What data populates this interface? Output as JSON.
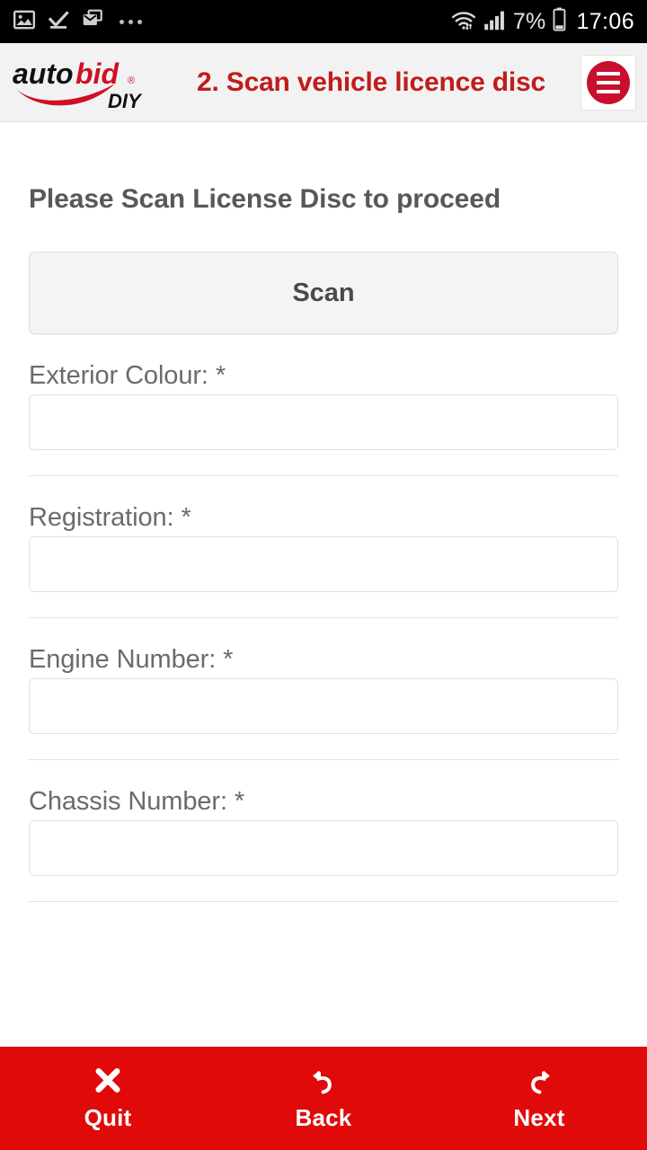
{
  "status_bar": {
    "left_icons": [
      "image-icon",
      "download-complete-icon",
      "email-icon",
      "more-icon"
    ],
    "wifi_icon": "wifi-icon",
    "signal_icon": "signal-bars-icon",
    "battery_percent": "7%",
    "battery_icon": "battery-icon",
    "time": "17:06"
  },
  "header": {
    "logo_text_1": "auto",
    "logo_text_2": "bid",
    "logo_registered": "®",
    "logo_sub": "DIY",
    "title": "2. Scan vehicle licence disc",
    "menu_icon": "hamburger-menu-icon"
  },
  "main": {
    "page_title": "Please Scan License Disc to proceed",
    "scan_label": "Scan",
    "fields": [
      {
        "label": "Exterior Colour: *",
        "value": "",
        "placeholder": ""
      },
      {
        "label": "Registration: *",
        "value": "",
        "placeholder": ""
      },
      {
        "label": "Engine Number: *",
        "value": "",
        "placeholder": ""
      },
      {
        "label": "Chassis Number: *",
        "value": "",
        "placeholder": ""
      }
    ]
  },
  "nav": {
    "buttons": [
      {
        "label": "Quit",
        "icon": "close-x-icon"
      },
      {
        "label": "Back",
        "icon": "undo-arrow-icon"
      },
      {
        "label": "Next",
        "icon": "redo-arrow-icon"
      }
    ]
  },
  "colors": {
    "brand_red": "#c8102e",
    "nav_red": "#e00a0a",
    "title_red": "#c21b1b",
    "header_bg": "#f2f2f2",
    "text_gray": "#6b6b6b"
  }
}
